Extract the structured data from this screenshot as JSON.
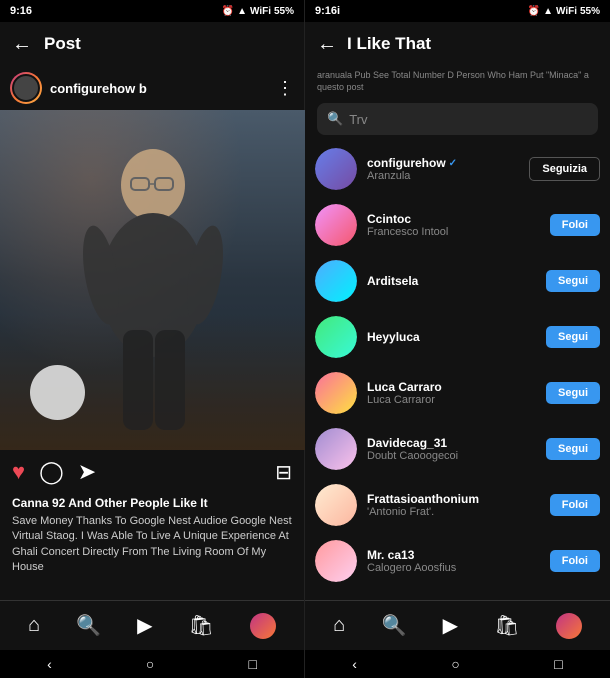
{
  "left": {
    "status_bar": {
      "time": "9:16",
      "battery": "55%"
    },
    "nav": {
      "title": "Post",
      "back_label": "←"
    },
    "post": {
      "username": "configurehow b",
      "actions": {
        "like_icon": "♥",
        "search_icon": "○",
        "share_icon": "▷",
        "bookmark_icon": "⊟"
      },
      "caption_likes": "Canna 92 And Other People Like It",
      "caption_text": "Save Money Thanks To Google Nest Audioe Google Nest Virtual Staog. I Was Able To Live A Unique Experience At Ghali Concert Directly From The Living Room Of My House"
    },
    "bottom_nav": {
      "home": "⌂",
      "search": "⊙",
      "reels": "▷",
      "shop": "⊕"
    },
    "system_nav": {
      "back": "‹",
      "home": "○",
      "recents": "□"
    }
  },
  "right": {
    "status_bar": {
      "time": "9:16i",
      "battery": "55%"
    },
    "nav": {
      "back_label": "←",
      "title": "I Like That"
    },
    "info_text": "aranuala Pub See Total Number D Person Who Ham Put \"Minaca\" a questo post",
    "search": {
      "placeholder": "Trv"
    },
    "likes": [
      {
        "username": "configurehow",
        "verified": true,
        "fullname": "Aranzula",
        "follow_label": "Seguizia",
        "follow_style": "outline",
        "avatar_grad": 0,
        "has_ring": false
      },
      {
        "username": "Ccintoc",
        "verified": false,
        "fullname": "Francesco Intool",
        "follow_label": "Foloi",
        "follow_style": "filled",
        "avatar_grad": 1,
        "has_ring": false
      },
      {
        "username": "Arditsela",
        "verified": false,
        "fullname": "",
        "follow_label": "Segui",
        "follow_style": "filled",
        "avatar_grad": 2,
        "has_ring": true
      },
      {
        "username": "Heyyluca",
        "verified": false,
        "fullname": "",
        "follow_label": "Segui",
        "follow_style": "filled",
        "avatar_grad": 3,
        "has_ring": false
      },
      {
        "username": "Luca Carraro",
        "verified": false,
        "fullname": "Luca Carraror",
        "follow_label": "Segui",
        "follow_style": "filled",
        "avatar_grad": 4,
        "has_ring": false
      },
      {
        "username": "Davidecag_31",
        "verified": false,
        "fullname": "Doubt Caooogecoi",
        "follow_label": "Segui",
        "follow_style": "filled",
        "avatar_grad": 5,
        "has_ring": false
      },
      {
        "username": "Frattasioanthonium",
        "verified": false,
        "fullname": "'Antonio Frat'.",
        "follow_label": "Foloi",
        "follow_style": "filled",
        "avatar_grad": 6,
        "has_ring": false
      },
      {
        "username": "Mr. ca13",
        "verified": false,
        "fullname": "Calogero Aoosfius",
        "follow_label": "Foloi",
        "follow_style": "filled",
        "avatar_grad": 7,
        "has_ring": false
      }
    ],
    "bottom_nav": {
      "home": "⌂",
      "search": "⊙",
      "reels": "▷",
      "shop": "⊕"
    },
    "system_nav": {
      "back": "‹",
      "home": "○",
      "recents": "□"
    }
  }
}
